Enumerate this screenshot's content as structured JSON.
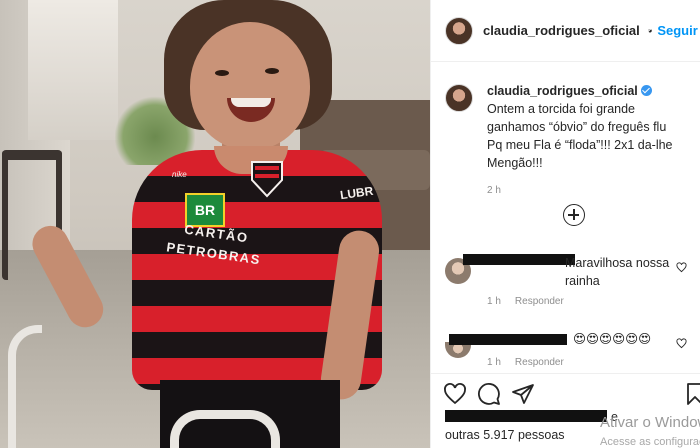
{
  "post": {
    "username": "claudia_rodrigues_oficial",
    "follow_label": "Seguir",
    "separator": "•",
    "caption_line1": "Ontem a torcida foi grande ganhamos “óbvio” do freguês flu",
    "caption_line2": "Pq meu Fla é “floda”!!! 2x1 da-lhe Mengão!!!",
    "posted_time": "2 h"
  },
  "photo": {
    "shirt_sponsor_br": "BR",
    "shirt_sponsor_text": "CARTÃO PETROBRAS",
    "shirt_sleeve_text": "LUBR",
    "shirt_brand": "nike"
  },
  "comments": [
    {
      "text": "Maravilhosa nossa rainha",
      "time": "1 h",
      "reply_label": "Responder"
    },
    {
      "text": "😍😍😍😍😍😍",
      "time": "1 h",
      "reply_label": "Responder"
    }
  ],
  "likes": {
    "suffix": "e",
    "others": "outras 5.917 pessoas"
  },
  "os_watermark": {
    "title": "Ativar o Windows",
    "subtitle": "Acesse as configurações"
  },
  "icons": [
    "verified-badge-icon",
    "add-comment-icon",
    "heart-icon",
    "comment-icon",
    "share-icon",
    "save-icon"
  ],
  "colors": {
    "link_blue": "#0095f6",
    "verified_blue": "#3897f0",
    "muted_text": "#8e8e8e",
    "flamengo_red": "#d8202b",
    "flamengo_black": "#1b1416"
  }
}
